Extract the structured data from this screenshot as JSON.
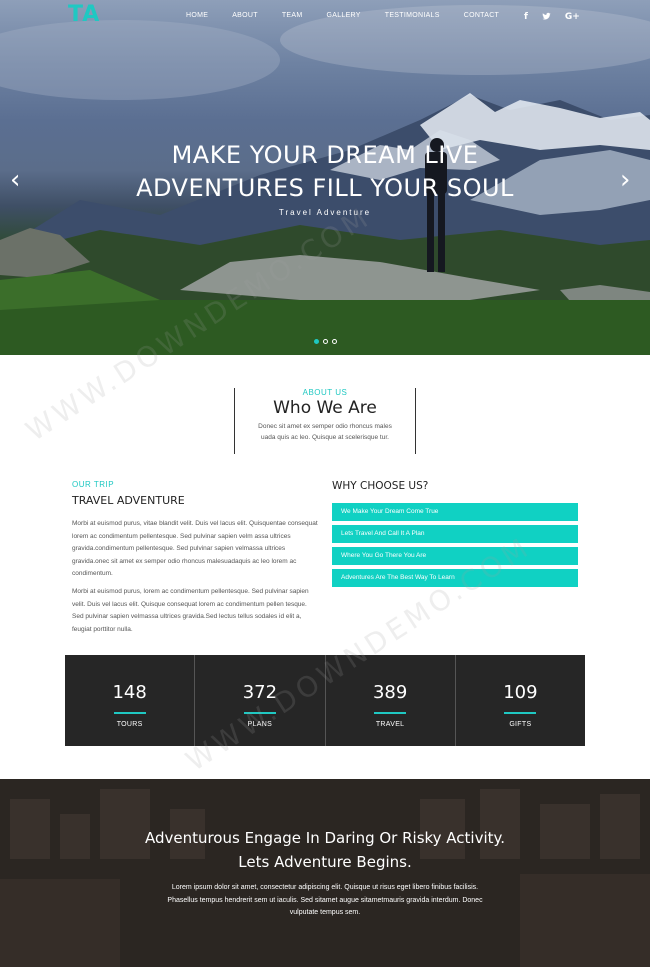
{
  "header": {
    "logo": "TA",
    "nav": [
      "HOME",
      "ABOUT",
      "TEAM",
      "GALLERY",
      "TESTIMONIALS",
      "CONTACT"
    ],
    "social": [
      {
        "icon": "facebook-icon",
        "glyph": "f"
      },
      {
        "icon": "twitter-icon",
        "glyph": "🐦"
      },
      {
        "icon": "google-plus-icon",
        "glyph": "G+"
      }
    ]
  },
  "hero": {
    "title_line1": "MAKE YOUR DREAM LIVE",
    "title_line2": "ADVENTURES FILL YOUR SOUL",
    "subtitle": "Travel Adventure",
    "prev_arrow": "‹",
    "next_arrow": "›",
    "slides_total": 3,
    "active_slide": 1
  },
  "about": {
    "kicker": "ABOUT US",
    "title": "Who We Are",
    "text": "Donec sit amet ex semper odio rhoncus males uada quis ac leo. Quisque at scelerisque tur."
  },
  "trip": {
    "kicker": "OUR TRIP",
    "title": "TRAVEL ADVENTURE",
    "paragraph1": "Morbi at euismod purus, vitae blandit velit. Duis vel lacus elit. Quisquentae consequat lorem ac condimentum pellentesque. Sed pulvinar sapien velm assa ultrices gravida.condimentum pellentesque. Sed pulvinar sapien velmassa ultrices gravida.onec sit amet ex semper odio rhoncus malesuadaquis ac leo lorem ac condimentum.",
    "paragraph2": "Morbi at euismod purus, lorem ac condimentum pellentesque. Sed pulvinar sapien velit. Duis vel lacus elit. Quisque consequat lorem ac condimentum pellen tesque. Sed pulvinar sapien velmassa ultrices gravida.Sed lectus tellus sodales id elit a, feugiat porttitor nulla."
  },
  "why": {
    "title": "WHY CHOOSE US?",
    "items": [
      "We Make Your Dream Come True",
      "Lets Travel And Call It A Plan",
      "Where You Go There You Are",
      "Adventures Are The Best Way To Learn"
    ]
  },
  "stats": [
    {
      "value": "148",
      "label": "TOURS"
    },
    {
      "value": "372",
      "label": "PLANS"
    },
    {
      "value": "389",
      "label": "TRAVEL"
    },
    {
      "value": "109",
      "label": "GIFTS"
    }
  ],
  "banner": {
    "title_line1": "Adventurous Engage In Daring Or Risky Activity.",
    "title_line2": "Lets Adventure Begins.",
    "text": "Lorem ipsum dolor sit amet, consectetur adipiscing elit. Quisque ut risus eget libero finibus facilisis. Phasellus tempus hendrerit sem ut iaculis. Sed sitamet augue sitametmauris gravida interdum. Donec vulputate tempus sem."
  },
  "watermark": "WWW.DOWNDEMO.COM",
  "colors": {
    "accent": "#1fc8c2",
    "button": "#10d1c3",
    "stats_bg": "#262626"
  }
}
